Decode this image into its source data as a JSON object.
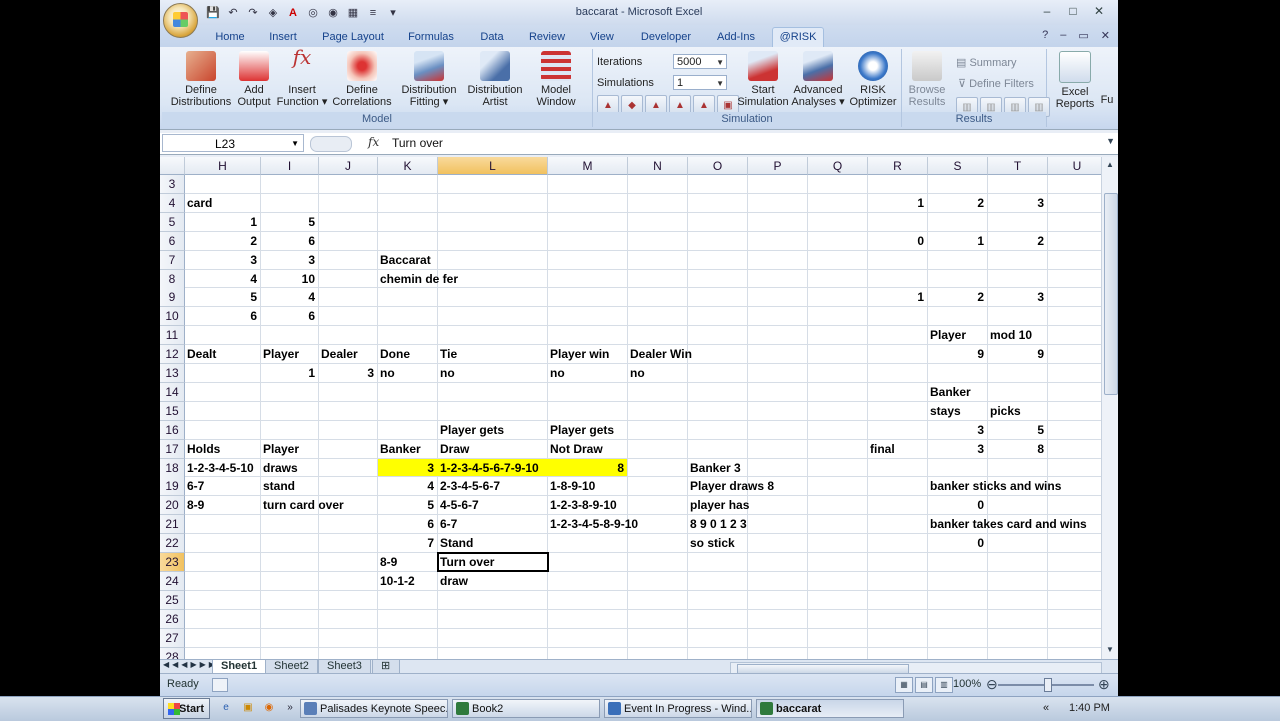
{
  "window": {
    "title": "baccarat - Microsoft Excel",
    "controls": [
      "–",
      "□",
      "✕"
    ]
  },
  "ribbon_tabs": [
    "Home",
    "Insert",
    "Page Layout",
    "Formulas",
    "Data",
    "Review",
    "View",
    "Developer",
    "Add-Ins",
    "@RISK"
  ],
  "active_tab": "@RISK",
  "ribbon": {
    "model": {
      "label": "Model",
      "buttons": [
        {
          "line1": "Define",
          "line2": "Distributions"
        },
        {
          "line1": "Add",
          "line2": "Output"
        },
        {
          "line1": "Insert",
          "line2": "Function ▾"
        },
        {
          "line1": "Define",
          "line2": "Correlations"
        },
        {
          "line1": "Distribution",
          "line2": "Fitting ▾"
        },
        {
          "line1": "Distribution",
          "line2": "Artist"
        },
        {
          "line1": "Model",
          "line2": "Window"
        }
      ]
    },
    "simulation": {
      "label": "Simulation",
      "iterations_label": "Iterations",
      "iterations_value": "5000",
      "simulations_label": "Simulations",
      "simulations_value": "1",
      "buttons": [
        {
          "line1": "Start",
          "line2": "Simulation"
        },
        {
          "line1": "Advanced",
          "line2": "Analyses ▾"
        },
        {
          "line1": "RISK",
          "line2": "Optimizer"
        }
      ]
    },
    "results": {
      "label": "Results",
      "browse_line1": "Browse",
      "browse_line2": "Results",
      "summary": "Summary",
      "define_filters": "Define Filters",
      "excel_line1": "Excel",
      "excel_line2": "Reports",
      "trunc": "Fu"
    }
  },
  "formula_bar": {
    "name_box": "L23",
    "fx": "fx",
    "content": "Turn over"
  },
  "columns": [
    "H",
    "I",
    "J",
    "K",
    "L",
    "M",
    "N",
    "O",
    "P",
    "Q",
    "R",
    "S",
    "T",
    "U"
  ],
  "rows": [
    "3",
    "4",
    "5",
    "6",
    "7",
    "8",
    "9",
    "10",
    "11",
    "12",
    "13",
    "14",
    "15",
    "16",
    "17",
    "18",
    "19",
    "20",
    "21",
    "22",
    "23",
    "24",
    "25",
    "26",
    "27",
    "28"
  ],
  "cells": {
    "H4": "card",
    "H5": "1",
    "I5": "5",
    "H6": "2",
    "I6": "6",
    "H7": "3",
    "I7": "3",
    "K7": "Baccarat",
    "H8": "4",
    "I8": "10",
    "K8": "chemin de fer",
    "H9": "5",
    "I9": "4",
    "H10": "6",
    "I10": "6",
    "R4": "1",
    "S4": "2",
    "T4": "3",
    "R6": "0",
    "S6": "1",
    "T6": "2",
    "R9": "1",
    "S9": "2",
    "T9": "3",
    "S11": "Player",
    "T11": "mod 10",
    "H12": "Dealt",
    "I12": "Player",
    "J12": "Dealer",
    "K12": "Done",
    "L12": "Tie",
    "M12": "Player win",
    "N12": "Dealer Win",
    "S12": "9",
    "T12": "9",
    "I13": "1",
    "J13": "3",
    "K13": "no",
    "L13": "no",
    "M13": "no",
    "N13": "no",
    "S14": "Banker",
    "S15": "stays",
    "T15": "picks",
    "L16": "Player gets",
    "M16": "Player gets",
    "S16": "3",
    "T16": "5",
    "H17": "Holds",
    "I17": "Player",
    "K17": "Banker",
    "L17": "Draw",
    "M17": "Not Draw",
    "R17": "final",
    "S17": "3",
    "T17": "8",
    "H18": "1-2-3-4-5-10",
    "I18": "draws",
    "K18": "3",
    "L18": "1-2-3-4-5-6-7-9-10",
    "M18": "8",
    "O18": "Banker 3",
    "H19": "6-7",
    "I19": "stand",
    "K19": "4",
    "L19": "2-3-4-5-6-7",
    "M19": "1-8-9-10",
    "O19": "Player draws 8",
    "S19": "banker sticks and wins",
    "H20": "8-9",
    "I20": "turn card over",
    "K20": "5",
    "L20": "4-5-6-7",
    "M20": "1-2-3-8-9-10",
    "O20": "player has",
    "S20": "0",
    "K21": "6",
    "L21": "6-7",
    "M21": "1-2-3-4-5-8-9-10",
    "O21": " 8 9 0 1 2 3",
    "S21": "banker takes card and wins",
    "K22": "7",
    "L22": "Stand",
    "O22": "so stick",
    "S22": "0",
    "K23": "8-9",
    "L23": "Turn over",
    "K24": "10-1-2",
    "L24": "draw"
  },
  "selected_cell": "L23",
  "sheets": [
    "Sheet1",
    "Sheet2",
    "Sheet3"
  ],
  "active_sheet": "Sheet1",
  "status": {
    "ready": "Ready",
    "zoom": "100%"
  },
  "taskbar": {
    "start": "Start",
    "buttons": [
      "Palisades Keynote Speec...",
      "Book2",
      "Event In Progress - Wind...",
      "baccarat"
    ],
    "active": "baccarat",
    "clock": "1:40 PM"
  },
  "colors": {
    "highlight": "#ffff00",
    "ribbon_text": "#15428b",
    "selected_header": "#f1c15f"
  }
}
